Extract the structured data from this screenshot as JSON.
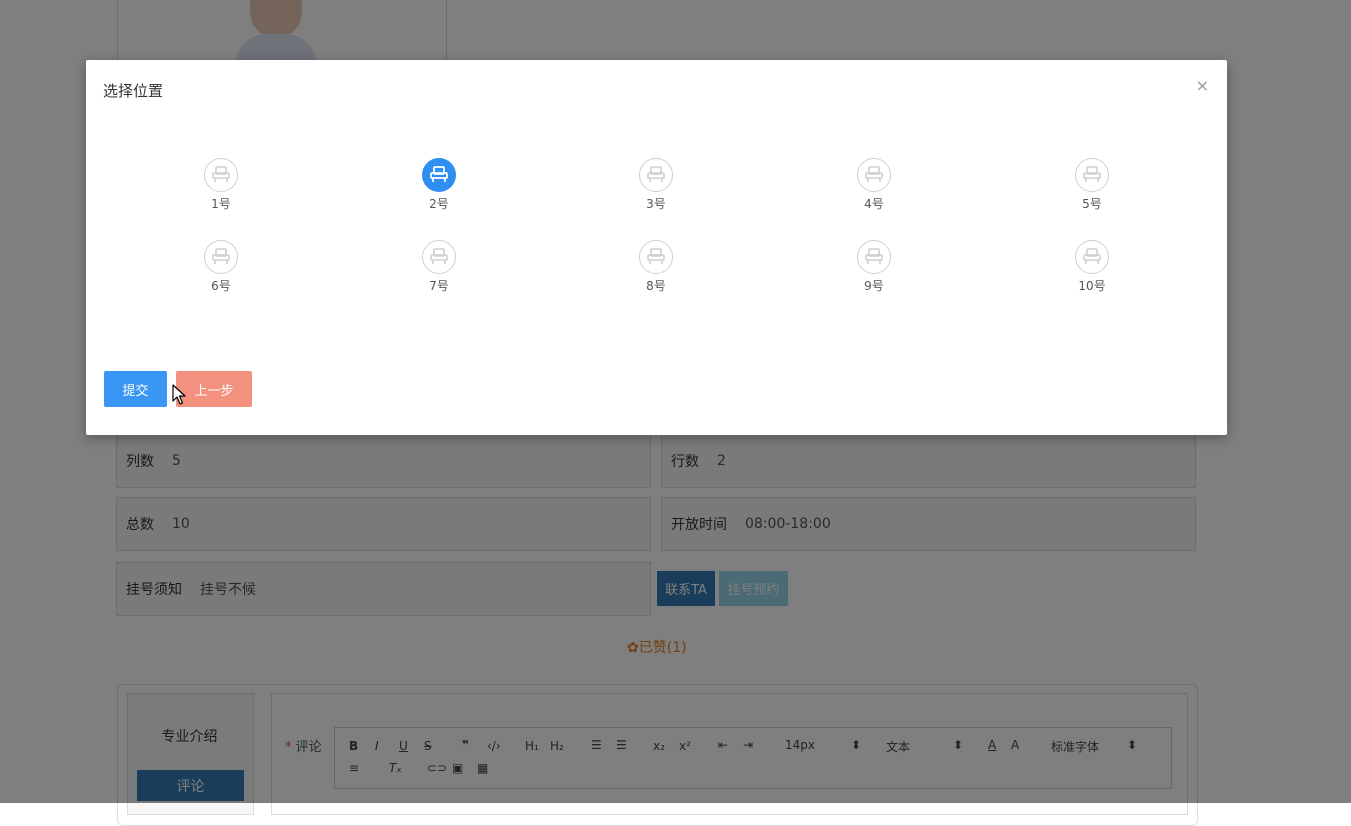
{
  "page": {
    "info": {
      "columns": {
        "label": "列数",
        "value": "5"
      },
      "rows": {
        "label": "行数",
        "value": "2"
      },
      "total": {
        "label": "总数",
        "value": "10"
      },
      "open_time": {
        "label": "开放时间",
        "value": "08:00-18:00"
      },
      "notice": {
        "label": "挂号须知",
        "value": "挂号不候"
      }
    },
    "buttons": {
      "contact": "联系TA",
      "reserve": "挂号预约"
    },
    "liked": "已赞(1)",
    "tabs": {
      "intro": "专业介绍",
      "comment": "评论"
    },
    "editor": {
      "label_star": "*",
      "label": "评论",
      "toolbar": {
        "font_size": "14px",
        "block_type": "文本",
        "font_family": "标准字体"
      }
    }
  },
  "modal": {
    "title": "选择位置",
    "close": "×",
    "seats": [
      {
        "label": "1号",
        "selected": false
      },
      {
        "label": "2号",
        "selected": true
      },
      {
        "label": "3号",
        "selected": false
      },
      {
        "label": "4号",
        "selected": false
      },
      {
        "label": "5号",
        "selected": false
      },
      {
        "label": "6号",
        "selected": false
      },
      {
        "label": "7号",
        "selected": false
      },
      {
        "label": "8号",
        "selected": false
      },
      {
        "label": "9号",
        "selected": false
      },
      {
        "label": "10号",
        "selected": false
      }
    ],
    "submit": "提交",
    "prev": "上一步"
  },
  "colors": {
    "primary": "#3a96f5",
    "secondary": "#f3907e",
    "selected_seat": "#2f8ff0"
  }
}
